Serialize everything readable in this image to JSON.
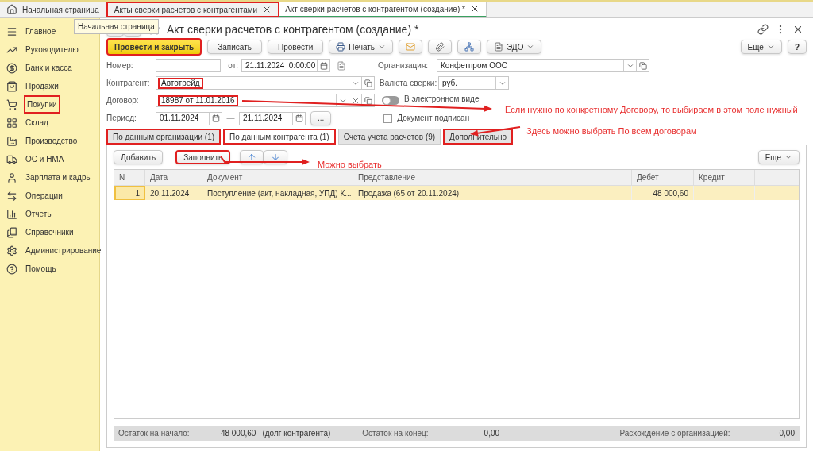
{
  "tabs": [
    {
      "label": "Начальная страница",
      "kind": "home",
      "selected": false,
      "highlighted": false
    },
    {
      "label": "Акты сверки расчетов с контрагентами",
      "kind": "closable",
      "selected": false,
      "highlighted": true
    },
    {
      "label": "Акт сверки расчетов с контрагентом (создание) *",
      "kind": "closable",
      "selected": true,
      "highlighted": false
    }
  ],
  "tooltip": "Начальная страница",
  "sidebar": {
    "items": [
      {
        "label": "Главное",
        "highlighted": false
      },
      {
        "label": "Руководителю",
        "highlighted": false
      },
      {
        "label": "Банк и касса",
        "highlighted": false
      },
      {
        "label": "Продажи",
        "highlighted": false
      },
      {
        "label": "Покупки",
        "highlighted": true
      },
      {
        "label": "Склад",
        "highlighted": false
      },
      {
        "label": "Производство",
        "highlighted": false
      },
      {
        "label": "ОС и НМА",
        "highlighted": false
      },
      {
        "label": "Зарплата и кадры",
        "highlighted": false
      },
      {
        "label": "Операции",
        "highlighted": false
      },
      {
        "label": "Отчеты",
        "highlighted": false
      },
      {
        "label": "Справочники",
        "highlighted": false
      },
      {
        "label": "Администрирование",
        "highlighted": false
      },
      {
        "label": "Помощь",
        "highlighted": false
      }
    ]
  },
  "form": {
    "title": "Акт сверки расчетов с контрагентом (создание) *",
    "toolbar": [
      {
        "label": "Провести и закрыть",
        "kind": "primary",
        "highlighted": true
      },
      {
        "label": "Записать",
        "kind": "text",
        "highlighted": false
      },
      {
        "label": "Провести",
        "kind": "text",
        "highlighted": false
      },
      {
        "label": "Печать",
        "kind": "print",
        "highlighted": false
      },
      {
        "kind": "mail",
        "highlighted": false
      },
      {
        "kind": "clip",
        "highlighted": false
      },
      {
        "kind": "struct",
        "highlighted": false
      },
      {
        "label": "ЭДО",
        "kind": "edo",
        "highlighted": false
      }
    ],
    "more": "Еще",
    "help": "?",
    "number": {
      "label": "Номер:"
    },
    "date": {
      "label": "от:",
      "value": "21.11.2024  0:00:00"
    },
    "organization": {
      "label": "Организация:",
      "value": "Конфетпром ООО"
    },
    "counterparty": {
      "label": "Контрагент:",
      "value": "Автотрейд",
      "highlighted": true
    },
    "currency": {
      "label": "Валюта сверки:",
      "value": "руб."
    },
    "contract": {
      "label": "Договор:",
      "value": "18987 от 11.01.2016",
      "highlighted": true
    },
    "electronic": {
      "label": "В электронном виде",
      "on": false
    },
    "period": {
      "label": "Период:",
      "from": "01.11.2024",
      "dash": "—",
      "to": "21.11.2024",
      "button": "..."
    },
    "signed": {
      "label": "Документ подписан",
      "checked": false
    }
  },
  "section_tabs": [
    {
      "label": "По данным организации (1)",
      "selected": false,
      "highlighted": true
    },
    {
      "label": "По данным контрагента (1)",
      "selected": true,
      "highlighted": true
    },
    {
      "label": "Счета учета расчетов (9)",
      "selected": false,
      "highlighted": false
    },
    {
      "label": "Дополнительно",
      "selected": false,
      "highlighted": true
    }
  ],
  "table_toolbar": {
    "add": "Добавить",
    "fill": "Заполнить",
    "fill_highlighted": true,
    "more": "Еще"
  },
  "table": {
    "columns": [
      "N",
      "Дата",
      "Документ",
      "Представление",
      "Дебет",
      "Кредит"
    ],
    "rows": [
      {
        "cells": [
          "1",
          "20.11.2024",
          "Поступление (акт, накладная, УПД) К...",
          "Продажа (65 от 20.11.2024)",
          "48 000,60",
          ""
        ],
        "selected": true
      }
    ]
  },
  "footer": {
    "start_label": "Остаток на начало:",
    "start_value": "-48 000,60",
    "start_note": "(долг контрагента)",
    "end_label": "Остаток на конец:",
    "end_value": "0,00",
    "diff_label": "Расхождение с организацией:",
    "diff_value": "0,00"
  },
  "annotations": [
    "Если нужно по конкретному Договору, то выбираем в этом поле нужный",
    "Здесь можно выбрать По всем договорам",
    "Можно выбрать"
  ]
}
